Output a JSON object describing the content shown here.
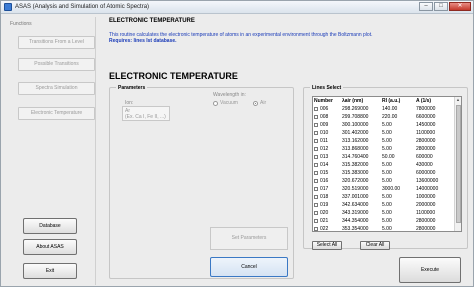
{
  "window": {
    "title": "ASAS (Analysis and Simulation of Atomic Spectra)",
    "controls": [
      "–",
      "□",
      "✕"
    ]
  },
  "sidebar": {
    "title": "Functions",
    "nav": [
      {
        "label": "Transitions From a Level"
      },
      {
        "label": "Possible Transitions"
      },
      {
        "label": "Spectra Simulation"
      },
      {
        "label": "Electronic Temperature"
      }
    ],
    "actions": [
      {
        "label": "Database"
      },
      {
        "label": "About ASAS"
      },
      {
        "label": "Exit"
      }
    ]
  },
  "header": {
    "title": "ELECTRONIC TEMPERATURE",
    "description": "This routine calculates the electronic temperature of atoms in an experimental environment through the Boltzmann plot.",
    "requires": "Requires: lines Ist database."
  },
  "section_title": "ELECTRONIC TEMPERATURE",
  "parameters": {
    "label": "Parameters",
    "ion_label": "Ion:",
    "ion_value": "Ar",
    "ion_hint": "(Ex. Ca I, Fe II, ...)",
    "wavelength_label": "Wavelength in:",
    "wavelength_options": [
      {
        "label": "Vacuum",
        "checked": false
      },
      {
        "label": "Air",
        "checked": true
      }
    ],
    "set_button": "Set Parameters"
  },
  "lines": {
    "label": "Lines Select",
    "columns": [
      "Number",
      "λair (nm)",
      "RI (a.u.)",
      "A (1/s)"
    ],
    "rows": [
      [
        "006",
        "298.269000",
        "140.00",
        "7800000"
      ],
      [
        "008",
        "299.708800",
        "220.00",
        "6600000"
      ],
      [
        "009",
        "300.100000",
        "5.00",
        "1450000"
      ],
      [
        "010",
        "301.402000",
        "5.00",
        "1100000"
      ],
      [
        "011",
        "313.162000",
        "5.00",
        "2800000"
      ],
      [
        "012",
        "313.868000",
        "5.00",
        "2800000"
      ],
      [
        "013",
        "314.760400",
        "50.00",
        "600000"
      ],
      [
        "014",
        "315.382000",
        "5.00",
        "430000"
      ],
      [
        "015",
        "315.383000",
        "5.00",
        "6000000"
      ],
      [
        "016",
        "320.672000",
        "5.00",
        "13600000"
      ],
      [
        "017",
        "320.519000",
        "3000.00",
        "14000000"
      ],
      [
        "018",
        "337.001000",
        "5.00",
        "1000000"
      ],
      [
        "019",
        "342.634000",
        "5.00",
        "2000000"
      ],
      [
        "020",
        "343.319000",
        "5.00",
        "1100000"
      ],
      [
        "021",
        "344.354000",
        "5.00",
        "2800000"
      ],
      [
        "022",
        "353.354000",
        "5.00",
        "2800000"
      ]
    ],
    "select_all": "Select All",
    "clear_all": "Clear All"
  },
  "buttons": {
    "cancel": "Cancel",
    "execute": "Execute"
  }
}
